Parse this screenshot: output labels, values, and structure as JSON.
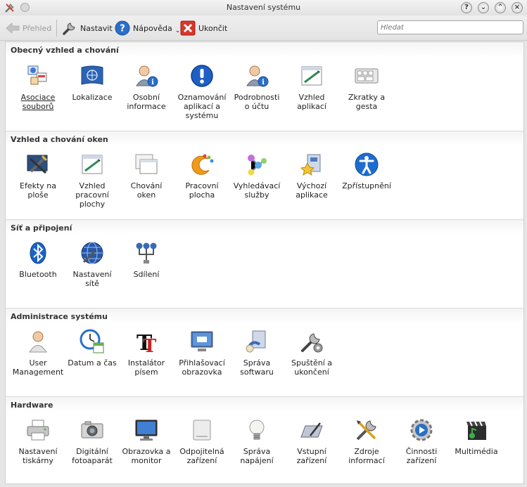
{
  "window": {
    "title": "Nastavení systému"
  },
  "toolbar": {
    "back_label": "Přehled",
    "configure_label": "Nastavit",
    "help_label": "Nápověda",
    "quit_label": "Ukončit",
    "search_placeholder": "Hledat"
  },
  "sections": [
    {
      "title": "Obecný vzhled a chování",
      "items": [
        {
          "label": "Asociace\nsouborů",
          "icon": "file-associations-icon"
        },
        {
          "label": "Lokalizace",
          "icon": "localization-flag-icon"
        },
        {
          "label": "Osobní\ninformace",
          "icon": "personal-info-icon"
        },
        {
          "label": "Oznamování\naplikací a\nsystému",
          "icon": "notification-icon"
        },
        {
          "label": "Podrobnosti\no účtu",
          "icon": "account-details-icon"
        },
        {
          "label": "Vzhled\naplikací",
          "icon": "app-appearance-icon"
        },
        {
          "label": "Zkratky a\ngesta",
          "icon": "keyboard-shortcuts-icon"
        }
      ]
    },
    {
      "title": "Vzhled a chování oken",
      "items": [
        {
          "label": "Efekty na\nploše",
          "icon": "desktop-effects-icon"
        },
        {
          "label": "Vzhled\npracovní\nplochy",
          "icon": "workspace-appearance-icon"
        },
        {
          "label": "Chování\noken",
          "icon": "window-behavior-icon"
        },
        {
          "label": "Pracovní\nplocha",
          "icon": "workspace-icon"
        },
        {
          "label": "Vyhledávací\nslužby",
          "icon": "search-services-icon"
        },
        {
          "label": "Výchozí\naplikace",
          "icon": "default-apps-icon"
        },
        {
          "label": "Zpřístupnění",
          "icon": "accessibility-icon"
        }
      ]
    },
    {
      "title": "Síť a připojení",
      "items": [
        {
          "label": "Bluetooth",
          "icon": "bluetooth-icon"
        },
        {
          "label": "Nastavení\nsítě",
          "icon": "network-settings-icon"
        },
        {
          "label": "Sdílení",
          "icon": "sharing-icon"
        }
      ]
    },
    {
      "title": "Administrace systému",
      "items": [
        {
          "label": "User\nManagement",
          "icon": "user-management-icon"
        },
        {
          "label": "Datum a čas",
          "icon": "date-time-icon"
        },
        {
          "label": "Instalátor\npísem",
          "icon": "font-installer-icon"
        },
        {
          "label": "Přihlašovací\nobrazovka",
          "icon": "login-screen-icon"
        },
        {
          "label": "Správa\nsoftwaru",
          "icon": "software-management-icon"
        },
        {
          "label": "Spuštění a\nukončení",
          "icon": "startup-shutdown-icon"
        }
      ]
    },
    {
      "title": "Hardware",
      "items": [
        {
          "label": "Nastavení\ntiskárny",
          "icon": "printer-icon"
        },
        {
          "label": "Digitální\nfotoaparát",
          "icon": "camera-icon"
        },
        {
          "label": "Obrazovka a\nmonitor",
          "icon": "monitor-icon"
        },
        {
          "label": "Odpojitelná\nzařízení",
          "icon": "removable-devices-icon"
        },
        {
          "label": "Správa\nnapájení",
          "icon": "power-management-icon"
        },
        {
          "label": "Vstupní\nzařízení",
          "icon": "input-devices-icon"
        },
        {
          "label": "Zdroje\ninformací",
          "icon": "info-sources-icon"
        },
        {
          "label": "Činnosti\nzařízení",
          "icon": "device-actions-icon"
        },
        {
          "label": "Multimédia",
          "icon": "multimedia-icon"
        }
      ]
    }
  ]
}
